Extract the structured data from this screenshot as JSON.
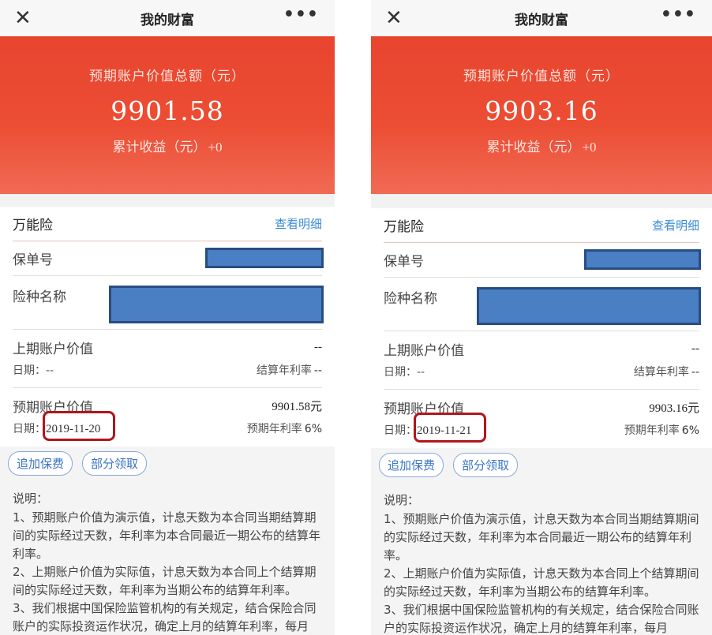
{
  "shared": {
    "nav_close": "✕",
    "nav_title": "我的财富",
    "nav_more": "•••",
    "hero_label": "预期账户价值总额（元）",
    "product_name": "万能险",
    "detail_link": "查看明细",
    "policy_no_label": "保单号",
    "risk_name_label": "险种名称",
    "last_value_label": "上期账户价值",
    "date_prefix": "日期：",
    "settle_rate_label": "结算年利率",
    "expected_value_label": "预期账户价值",
    "expected_rate_label": "预期年利率",
    "btn_add": "追加保费",
    "btn_withdraw": "部分领取",
    "notes_title": "说明：",
    "notes": [
      "1、预期账户价值为演示值，计息天数为本合同当期结算期间的实际经过天数，年利率为本合同最近一期公布的结算年利率。",
      "2、上期账户价值为实际值，计息天数为本合同上个结算期间的实际经过天数，年利率为当期公布的结算年利率。",
      "3、我们根据中国保险监管机构的有关规定，结合保险合同账户的实际投资运作状况，确定上月的结算年利率，每月"
    ]
  },
  "left": {
    "hero_amount": "9901.58",
    "income_label": "累计收益（元）",
    "income_value": "+0",
    "last_value": "--",
    "last_date": "--",
    "settle_rate": "--",
    "expected_value": "9901.58元",
    "expected_date": "2019-11-20",
    "expected_rate": "6%"
  },
  "right": {
    "hero_amount": "9903.16",
    "income_label": "累计收益（元）",
    "income_value": "+0",
    "last_value": "--",
    "last_date": "--",
    "settle_rate": "--",
    "expected_value": "9903.16元",
    "expected_date": "2019-11-21",
    "expected_rate": "6%"
  },
  "colors": {
    "hero_red": "#ec4d33",
    "link_blue": "#3a8bd6",
    "redaction_blue": "#4a7fc4",
    "highlight_red": "#b2151b"
  }
}
